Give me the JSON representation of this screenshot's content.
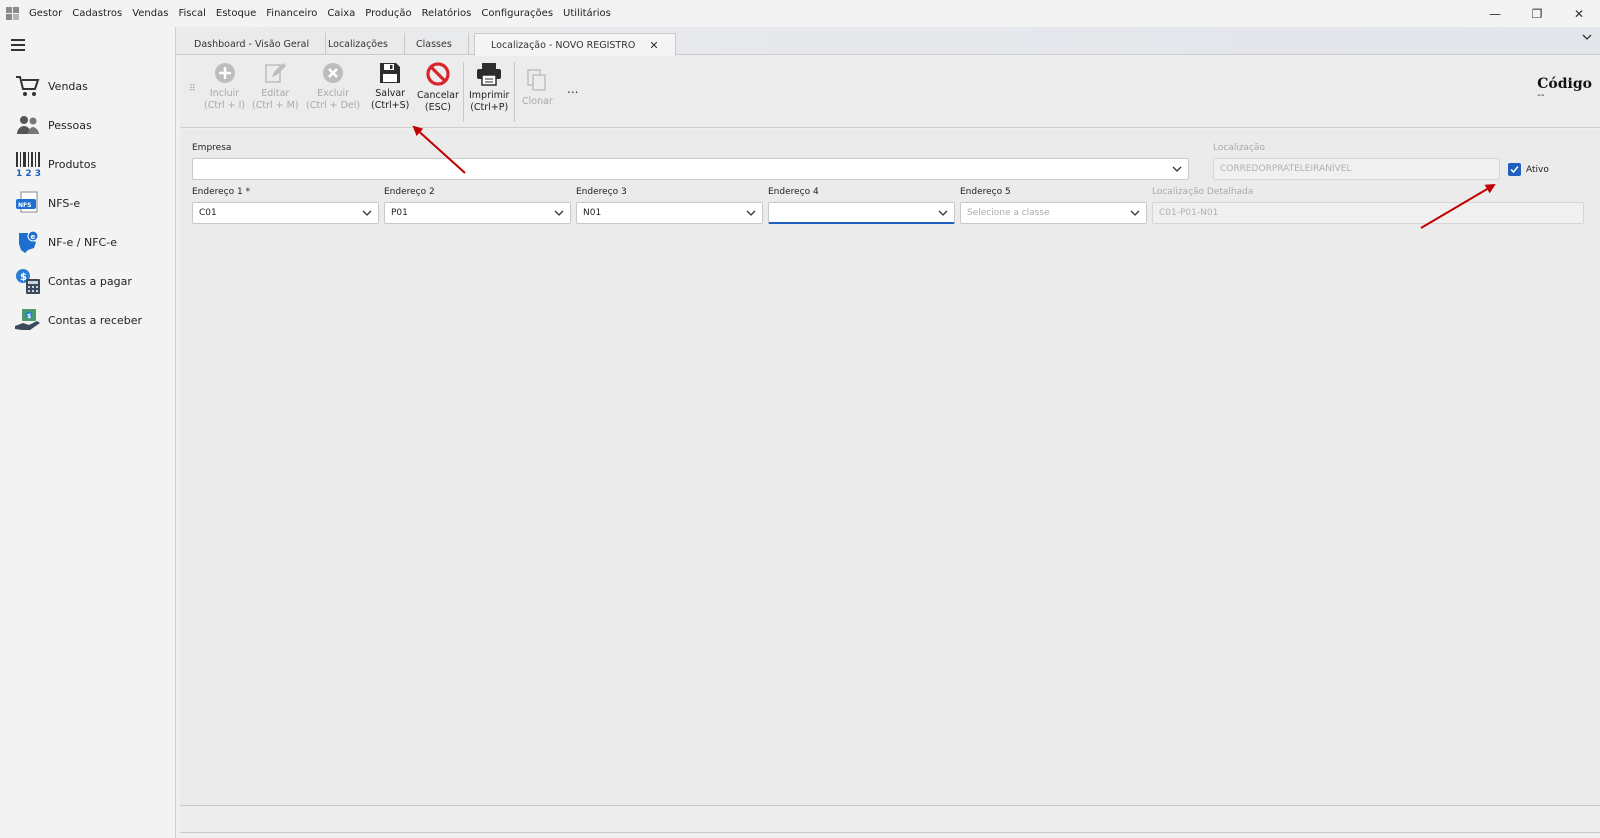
{
  "menu": [
    "Gestor",
    "Cadastros",
    "Vendas",
    "Fiscal",
    "Estoque",
    "Financeiro",
    "Caixa",
    "Produção",
    "Relatórios",
    "Configurações",
    "Utilitários"
  ],
  "window_controls": {
    "minimize": "—",
    "restore": "❐",
    "close": "✕"
  },
  "sidebar": {
    "items": [
      {
        "label": "Vendas",
        "icon": "cart-icon"
      },
      {
        "label": "Pessoas",
        "icon": "people-icon"
      },
      {
        "label": "Produtos",
        "icon": "barcode-icon"
      },
      {
        "label": "NFS-e",
        "icon": "nfse-icon"
      },
      {
        "label": "NF-e / NFC-e",
        "icon": "nfe-icon"
      },
      {
        "label": "Contas a pagar",
        "icon": "bills-pay-icon"
      },
      {
        "label": "Contas a receber",
        "icon": "bills-receive-icon"
      }
    ]
  },
  "tabs": [
    {
      "label": "Dashboard - Visão Geral"
    },
    {
      "label": "Localizações"
    },
    {
      "label": "Classes"
    },
    {
      "label": "Localização - NOVO REGISTRO",
      "close": "✕"
    }
  ],
  "toolbar": {
    "incluir": {
      "line1": "Incluir",
      "line2": "(Ctrl + I)"
    },
    "editar": {
      "line1": "Editar",
      "line2": "(Ctrl + M)"
    },
    "excluir": {
      "line1": "Excluir",
      "line2": "(Ctrl + Del)"
    },
    "salvar": {
      "line1": "Salvar",
      "line2": "(Ctrl+S)"
    },
    "cancelar": {
      "line1": "Cancelar",
      "line2": "(ESC)"
    },
    "imprimir": {
      "line1": "Imprimir",
      "line2": "(Ctrl+P)"
    },
    "clonar": {
      "line1": "Clonar"
    },
    "more": "...",
    "codigo_label": "Código",
    "codigo_value": "--"
  },
  "form": {
    "empresa": {
      "label": "Empresa",
      "value": ""
    },
    "localizacao": {
      "label": "Localização",
      "value": "CORREDORPRATELEIRANÍVEL"
    },
    "ativo": {
      "label": "Ativo",
      "checked": true
    },
    "endereco1": {
      "label": "Endereço 1 *",
      "value": "C01"
    },
    "endereco2": {
      "label": "Endereço 2",
      "value": "P01"
    },
    "endereco3": {
      "label": "Endereço 3",
      "value": "N01"
    },
    "endereco4": {
      "label": "Endereço 4",
      "value": ""
    },
    "endereco5": {
      "label": "Endereço 5",
      "placeholder": "Selecione a classe"
    },
    "localizacao_detalhada": {
      "label": "Localização Detalhada",
      "value": "C01-P01-N01"
    }
  },
  "colors": {
    "accent": "#1f5fbf",
    "annotation_arrow": "#c00000",
    "cancel_red": "#d9232e"
  }
}
